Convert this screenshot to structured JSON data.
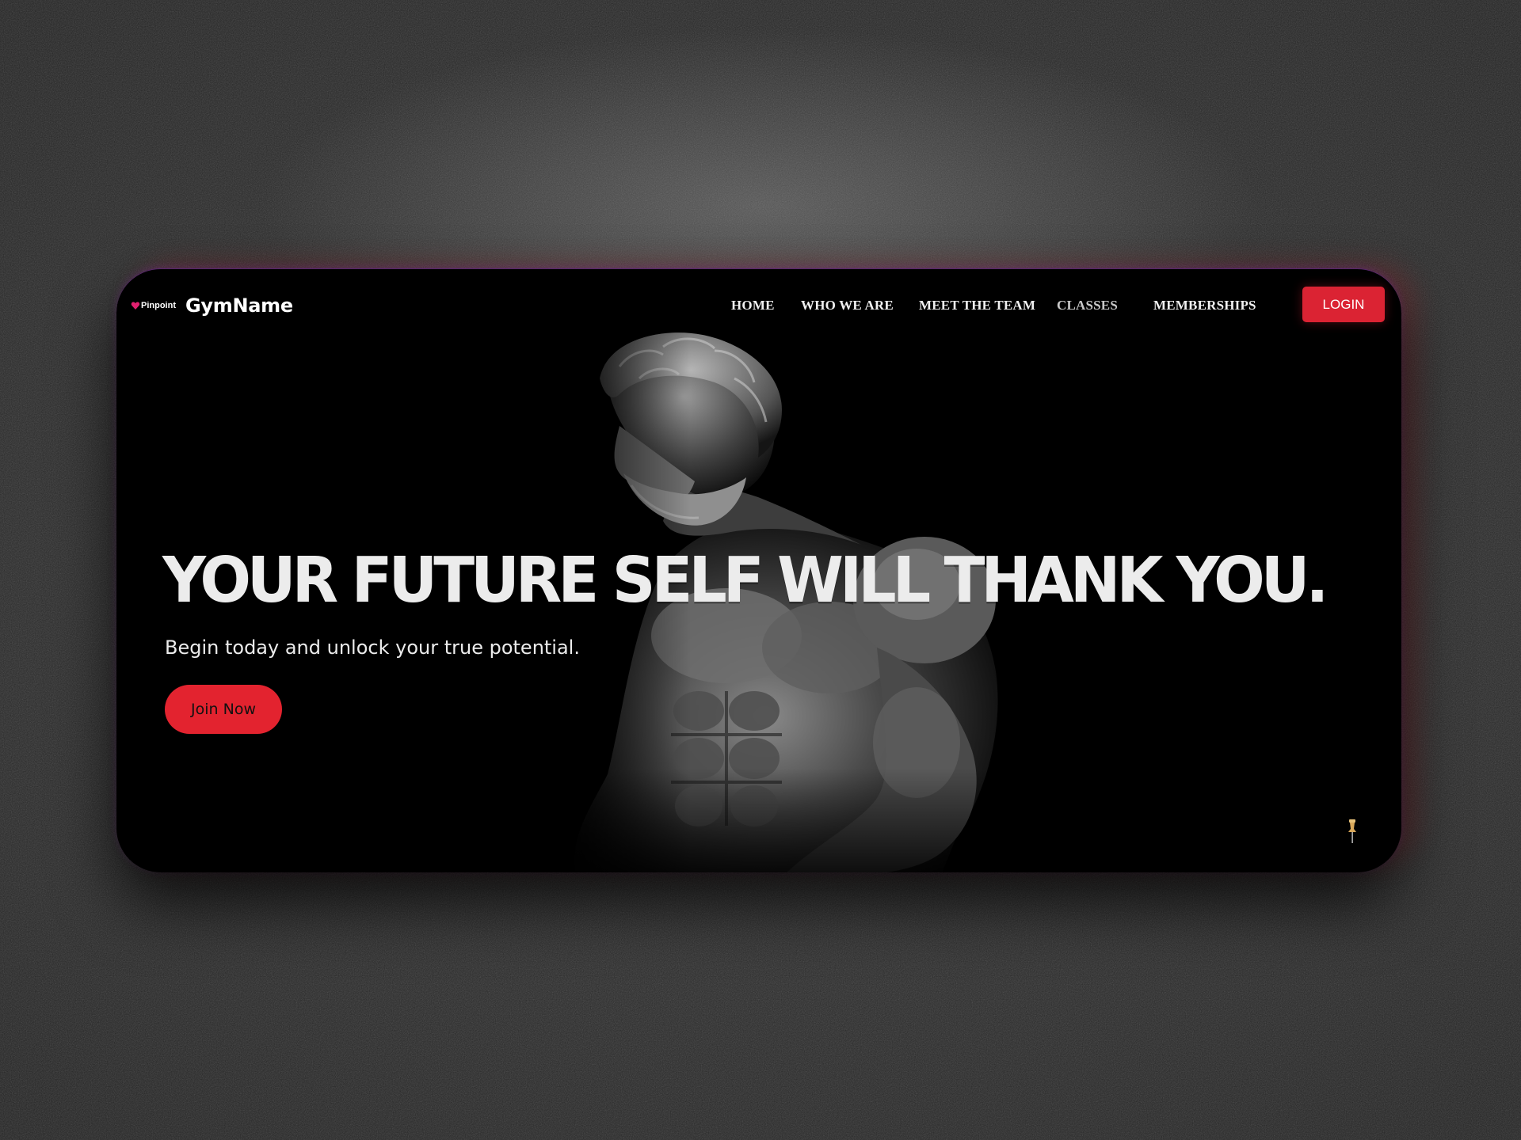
{
  "brand": {
    "mark_label": "Pinpoint",
    "name": "GymName",
    "accent_color": "#db2333"
  },
  "nav": {
    "items": [
      {
        "label": "HOME"
      },
      {
        "label": "WHO WE ARE"
      },
      {
        "label": "MEET THE TEAM"
      },
      {
        "label": "CLASSES"
      },
      {
        "label": "MEMBERSHIPS"
      }
    ],
    "login_label": "LOGIN"
  },
  "hero": {
    "headline": "YOUR FUTURE SELF WILL THANK YOU.",
    "subheadline": "Begin today and unlock your true potential.",
    "cta_label": "Join Now",
    "image": "muscular-statue"
  },
  "icons": {
    "brand": "heart-pin-icon",
    "corner": "pushpin-icon"
  }
}
